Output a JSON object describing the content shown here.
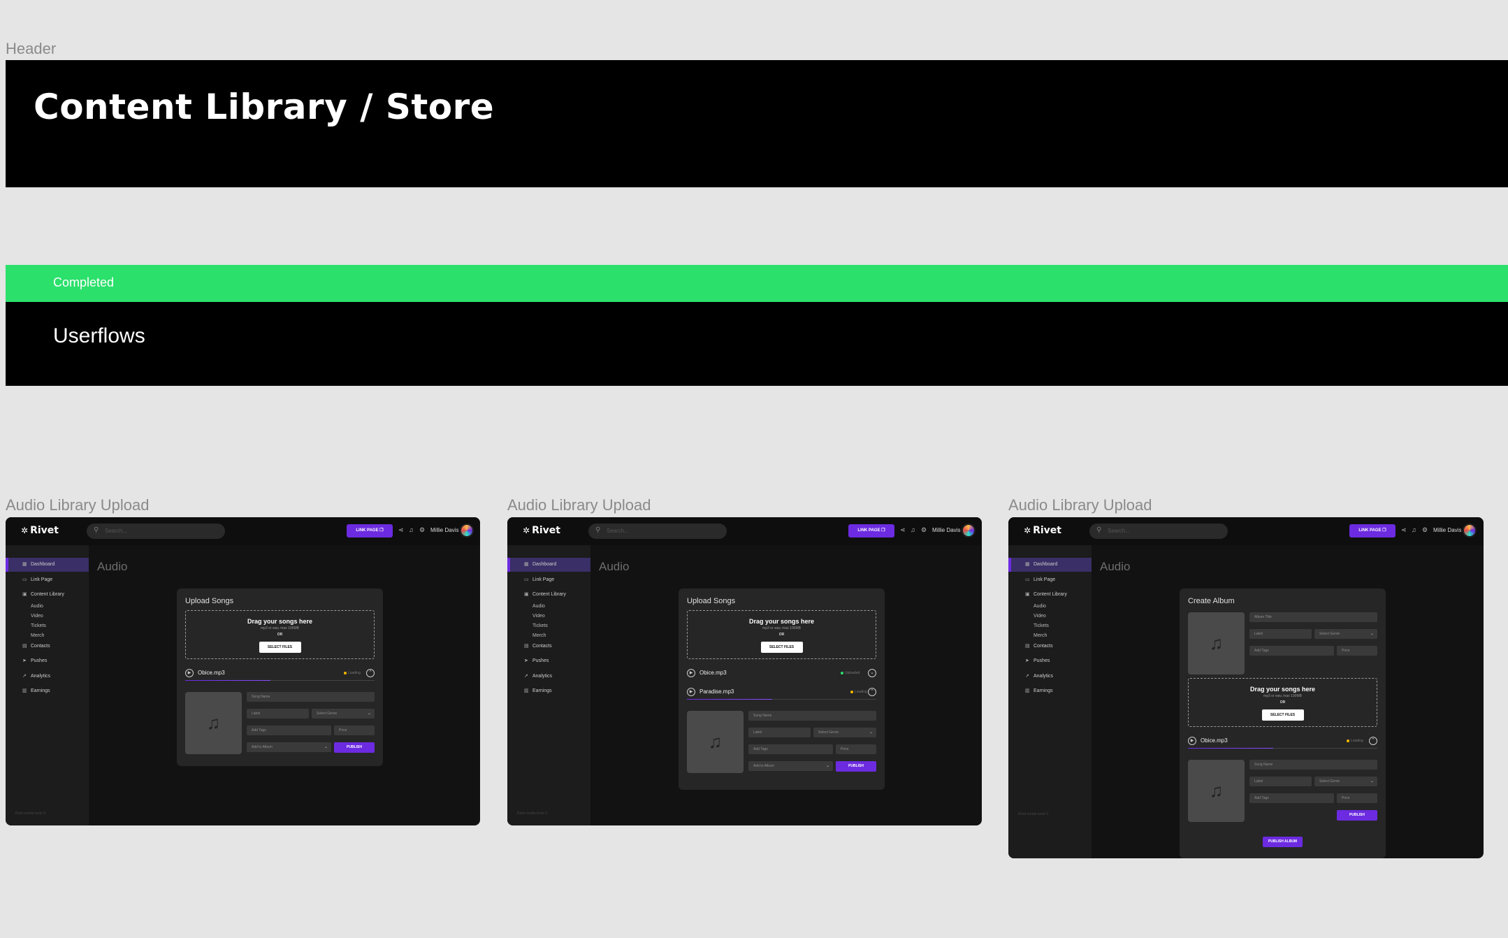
{
  "header": {
    "section_label": "Header",
    "title": "Content Library / Store"
  },
  "status": {
    "label": "Completed",
    "color": "#2be06b"
  },
  "userflows": {
    "title": "Userflows"
  },
  "frames": [
    {
      "label": "Audio Library Upload",
      "brand": "Rivet",
      "search_placeholder": "Search...",
      "link_page_label": "LINK PAGE",
      "username": "Millie Davis",
      "nav": [
        "Dashboard",
        "Link Page",
        "Content Library",
        "Contacts",
        "Pushes",
        "Analytics",
        "Earnings"
      ],
      "subnav": [
        "Audio",
        "Video",
        "Tickets",
        "Merch"
      ],
      "footer_text": "Rivet media tools ©",
      "page_title": "Audio",
      "card_title": "Upload Songs",
      "dropzone": {
        "title": "Drag your songs here",
        "sub": "mp3 or wav, max 100MB",
        "or": "OR",
        "button": "SELECT FILES"
      },
      "files": [
        {
          "name": "Obice.mp3",
          "status": "Loading",
          "dot_color": "#f5b700",
          "progress": 0.45
        }
      ],
      "form": {
        "song_name": "Song Name",
        "label": "Label",
        "genre": "Select Genre",
        "tags": "Add Tags",
        "price": "Price",
        "album": "Add to Album",
        "publish": "PUBLISH"
      }
    },
    {
      "label": "Audio Library Upload",
      "brand": "Rivet",
      "search_placeholder": "Search...",
      "link_page_label": "LINK PAGE",
      "username": "Millie Davis",
      "nav": [
        "Dashboard",
        "Link Page",
        "Content Library",
        "Contacts",
        "Pushes",
        "Analytics",
        "Earnings"
      ],
      "subnav": [
        "Audio",
        "Video",
        "Tickets",
        "Merch"
      ],
      "footer_text": "Rivet media tools ©",
      "page_title": "Audio",
      "card_title": "Upload Songs",
      "dropzone": {
        "title": "Drag your songs here",
        "sub": "mp3 or wav, max 100MB",
        "or": "OR",
        "button": "SELECT FILES"
      },
      "files": [
        {
          "name": "Obice.mp3",
          "status": "Uploaded",
          "dot_color": "#2be06b",
          "progress": 1.0
        },
        {
          "name": "Paradise.mp3",
          "status": "Loading",
          "dot_color": "#f5b700",
          "progress": 0.45
        }
      ],
      "form": {
        "song_name": "Song Name",
        "label": "Label",
        "genre": "Select Genre",
        "tags": "Add Tags",
        "price": "Price",
        "album": "Add to Album",
        "publish": "PUBLISH"
      }
    },
    {
      "label": "Audio Library Upload",
      "brand": "Rivet",
      "search_placeholder": "Search...",
      "link_page_label": "LINK PAGE",
      "username": "Millie Davis",
      "nav": [
        "Dashboard",
        "Link Page",
        "Content Library",
        "Contacts",
        "Pushes",
        "Analytics",
        "Earnings"
      ],
      "subnav": [
        "Audio",
        "Video",
        "Tickets",
        "Merch"
      ],
      "footer_text": "Rivet media tools ©",
      "page_title": "Audio",
      "card_title": "Create Album",
      "album_form": {
        "album_title": "Album Title",
        "label": "Label",
        "genre": "Select Genre",
        "tags": "Add Tags",
        "price": "Price"
      },
      "dropzone": {
        "title": "Drag your songs here",
        "sub": "mp3 or wav, max 100MB",
        "or": "OR",
        "button": "SELECT FILES"
      },
      "files": [
        {
          "name": "Obice.mp3",
          "status": "Loading",
          "dot_color": "#f5b700",
          "progress": 0.45
        }
      ],
      "form": {
        "song_name": "Song Name",
        "label": "Label",
        "genre": "Select Genre",
        "tags": "Add Tags",
        "price": "Price",
        "publish": "PUBLISH"
      },
      "publish_album": "PUBLISH ALBUM"
    }
  ]
}
